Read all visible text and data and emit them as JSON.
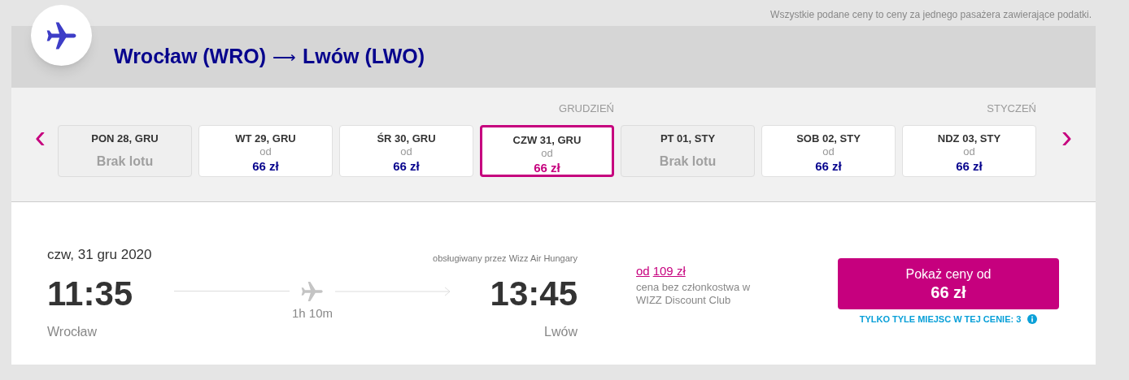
{
  "notice": "Wszystkie podane ceny to ceny za jednego pasażera zawierające podatki.",
  "route": {
    "origin": "Wrocław (WRO)",
    "arrow": "⟶",
    "destination": "Lwów (LWO)"
  },
  "date_strip": {
    "prev": "‹",
    "next": "›",
    "days": [
      {
        "label": "PON 28, GRU",
        "available": false,
        "note": "Brak lotu",
        "selected": false
      },
      {
        "label": "WT 29, GRU",
        "available": true,
        "from": "od",
        "price": "66 zł",
        "selected": false
      },
      {
        "label": "ŚR 30, GRU",
        "available": true,
        "from": "od",
        "price": "66 zł",
        "selected": false
      },
      {
        "label": "CZW 31, GRU",
        "available": true,
        "from": "od",
        "price": "66 zł",
        "selected": true,
        "month": "GRUDZIEŃ"
      },
      {
        "label": "PT 01, STY",
        "available": false,
        "note": "Brak lotu",
        "selected": false
      },
      {
        "label": "SOB 02, STY",
        "available": true,
        "from": "od",
        "price": "66 zł",
        "selected": false
      },
      {
        "label": "NDZ 03, STY",
        "available": true,
        "from": "od",
        "price": "66 zł",
        "selected": false,
        "month": "STYCZEŃ"
      }
    ]
  },
  "flight": {
    "date": "czw, 31 gru 2020",
    "operator": "obsługiwany przez Wizz Air Hungary",
    "departure_time": "11:35",
    "departure_city": "Wrocław",
    "duration": "1h 10m",
    "arrival_time": "13:45",
    "arrival_city": "Lwów",
    "regular_from": "od",
    "regular_price": "109 zł",
    "regular_note": "cena bez członkostwa w WIZZ Discount Club",
    "button_line1": "Pokaż ceny od",
    "button_price": "66 zł",
    "seats_left": "TYLKO TYLE MIEJSC W TEJ CENIE: 3"
  }
}
